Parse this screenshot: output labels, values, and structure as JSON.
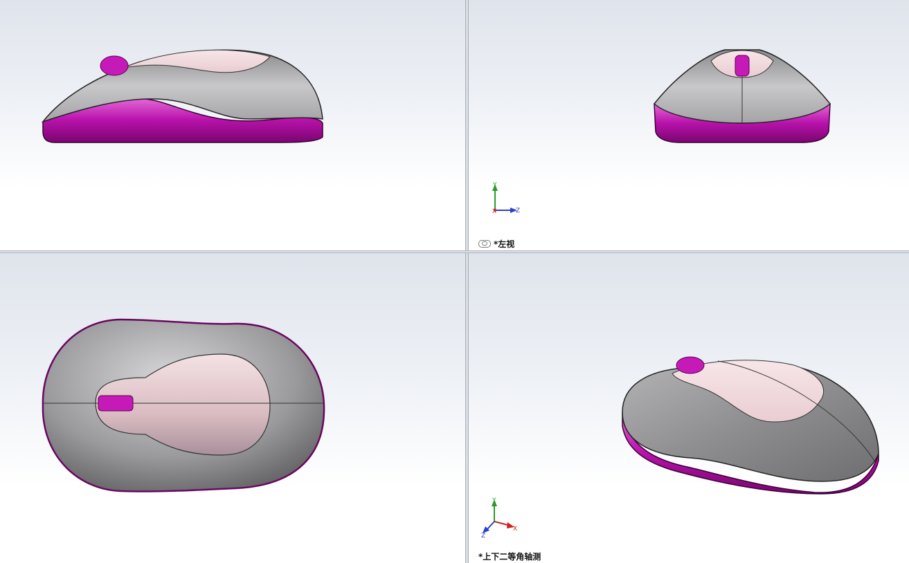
{
  "viewports": {
    "left_view": {
      "label": "*左视",
      "triad": {
        "y": "Y",
        "x": "X",
        "z": "Z"
      }
    },
    "isometric_view": {
      "label": "*上下二等角轴测",
      "triad": {
        "y": "Y",
        "x": "X",
        "z": "Z"
      }
    }
  },
  "colors": {
    "body_gray": "#9c9c9e",
    "top_pink": "#f2d9dc",
    "accent_magenta": "#c419b8",
    "axis_y": "#2a9a2a",
    "axis_z": "#2a40d0",
    "axis_x": "#d02020"
  },
  "icons": {
    "link": "link-icon",
    "triad": "coordinate-triad-icon"
  }
}
